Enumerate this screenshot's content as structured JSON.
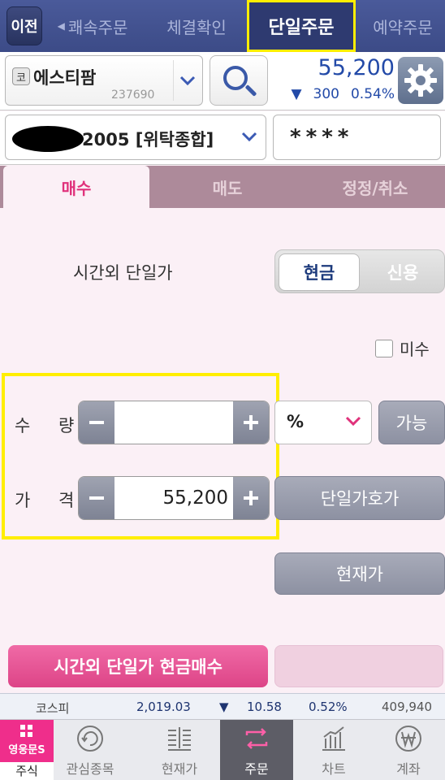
{
  "topnav": {
    "back_label": "이전",
    "tabs": [
      {
        "label": "쾌속주문"
      },
      {
        "label": "체결확인"
      },
      {
        "label": "단일주문"
      },
      {
        "label": "예약주문"
      }
    ]
  },
  "stock": {
    "market_badge": "코",
    "name": "에스티팜",
    "code": "237690",
    "price": "55,200",
    "change": "300",
    "change_pct": "0.54%",
    "down_arrow": "▼",
    "accent_color": "#234aa8"
  },
  "account": {
    "number_suffix": "2005 [위탁종합]",
    "password_masked": "****"
  },
  "order_tabs": [
    {
      "label": "매수"
    },
    {
      "label": "매도"
    },
    {
      "label": "정정/취소"
    }
  ],
  "order": {
    "session_label": "시간외 단일가",
    "payment_options": [
      {
        "label": "현금"
      },
      {
        "label": "신용"
      }
    ],
    "misu_label": "미수",
    "quantity_label": "수 량",
    "quantity_value": "",
    "unit_value": "%",
    "available_label": "가능",
    "price_label": "가 격",
    "price_value": "55,200",
    "quote_button": "단일가호가",
    "current_price_button": "현재가",
    "submit_label": "시간외 단일가 현금매수"
  },
  "ticker": {
    "index_name": "코스피",
    "value": "2,019.03",
    "arrow": "▼",
    "change": "10.58",
    "change_pct": "0.52%",
    "volume": "409,940"
  },
  "bottom_nav": {
    "logo_text": "영웅문S",
    "items": [
      {
        "label": "주식",
        "icon": "grid-icon"
      },
      {
        "label": "관심종목",
        "icon": "refresh-circle-icon"
      },
      {
        "label": "현재가",
        "icon": "price-list-icon"
      },
      {
        "label": "주문",
        "icon": "exchange-icon"
      },
      {
        "label": "차트",
        "icon": "chart-icon"
      },
      {
        "label": "계좌",
        "icon": "won-icon"
      }
    ]
  },
  "colors": {
    "nav_bg": "#3c4b87",
    "highlight": "#ffee00",
    "buy_pink": "#e0327b",
    "price_blue": "#234aa8"
  }
}
